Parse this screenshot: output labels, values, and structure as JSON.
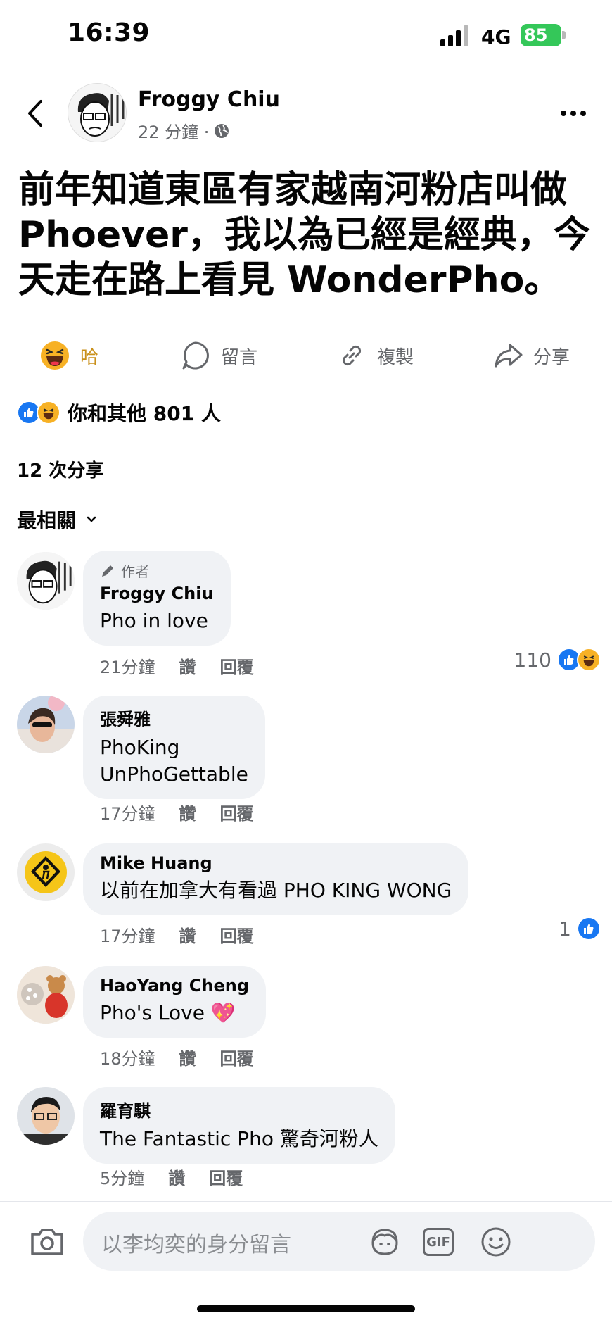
{
  "status_bar": {
    "time": "16:39",
    "network": "4G",
    "battery": "85"
  },
  "post": {
    "author": "Froggy Chiu",
    "time": "22 分鐘 ·",
    "text": "前年知道東區有家越南河粉店叫做 Phoever，我以為已經是經典，今天走在路上看見 WonderPho。"
  },
  "actions": {
    "haha": "哈",
    "comment": "留言",
    "copy": "複製",
    "share": "分享"
  },
  "reactions_summary": "你和其他 801 人",
  "share_count": "12 次分享",
  "sort_label": "最相關",
  "comments": [
    {
      "badge": "作者",
      "name": "Froggy Chiu",
      "text": "Pho in love",
      "time": "21分鐘",
      "like": "讚",
      "reply": "回覆",
      "reaction_count": "110"
    },
    {
      "name": "張舜雅",
      "text": "PhoKing\nUnPhoGettable",
      "time": "17分鐘",
      "like": "讚",
      "reply": "回覆"
    },
    {
      "name": "Mike Huang",
      "text": "以前在加拿大有看過 PHO KING WONG",
      "time": "17分鐘",
      "like": "讚",
      "reply": "回覆",
      "reaction_count": "1"
    },
    {
      "name": "HaoYang Cheng",
      "text": "Pho's Love 💖",
      "time": "18分鐘",
      "like": "讚",
      "reply": "回覆"
    },
    {
      "name": "羅育騏",
      "text": "The Fantastic Pho 驚奇河粉人",
      "time": "5分鐘",
      "like": "讚",
      "reply": "回覆"
    }
  ],
  "composer": {
    "placeholder": "以李均奕的身分留言",
    "gif": "GIF"
  }
}
